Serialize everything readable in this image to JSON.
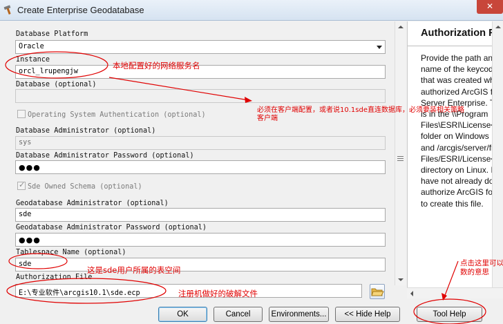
{
  "window": {
    "title": "Create Enterprise Geodatabase",
    "close_label": "✕"
  },
  "form": {
    "platform_label": "Database Platform",
    "platform_value": "Oracle",
    "instance_label": "Instance",
    "instance_value": "orcl_lrupengjw",
    "database_label": "Database (optional)",
    "database_value": "",
    "os_auth_label": "Operating System Authentication (optional)",
    "os_auth_checked": false,
    "db_admin_label": "Database Administrator (optional)",
    "db_admin_value": "sys",
    "db_admin_password_label": "Database Administrator Password (optional)",
    "db_admin_password_value": "●●●",
    "sde_schema_label": "Sde Owned Schema (optional)",
    "sde_schema_checked": true,
    "gdb_admin_label": "Geodatabase Administrator (optional)",
    "gdb_admin_value": "sde",
    "gdb_admin_password_label": "Geodatabase Administrator Password (optional)",
    "gdb_admin_password_value": "●●●",
    "tablespace_label": "Tablespace Name (optional)",
    "tablespace_value": "sde",
    "auth_file_label": "Authorization File",
    "auth_file_value": "E:\\专业软件\\arcgis10.1\\sde.ecp"
  },
  "help": {
    "title": "Authorization Fi",
    "lines": [
      "Provide the path and",
      "name of the keycode",
      "that was created whe",
      "authorized ArcGIS fo",
      "Server Enterprise. Th",
      "is in the \\\\Program",
      "Files\\ESRI\\License<",
      "folder on Windows",
      "and /arcgis/server/fra",
      "Files/ESRI/License<",
      "directory on Linux. If",
      "have not already don",
      "authorize ArcGIS for",
      "to create this file."
    ]
  },
  "buttons": {
    "ok": "OK",
    "cancel": "Cancel",
    "environments": "Environments...",
    "hide_help": "<< Hide Help",
    "tool_help": "Tool Help"
  },
  "annotations": {
    "instance_note": "本地配置好的网络服务名",
    "client_note_line1": "必须在客户端配置，或者说10.1sde直连数据库，必须要装相关策略",
    "client_note_line2": "客户端",
    "tablespace_note": "这是sde用户所属的表空间",
    "auth_file_note": "注册机做好的破解文件",
    "tool_help_note_line1": "点击这里可以",
    "tool_help_note_line2": "数的意思"
  },
  "colors": {
    "annotation": "#e00000",
    "title_bar": "#dce7f3",
    "help_background": "#ffffff"
  }
}
